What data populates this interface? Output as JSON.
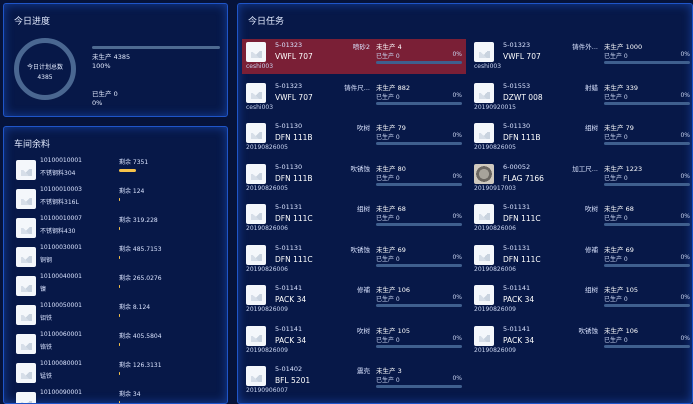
{
  "progress": {
    "title": "今日进度",
    "ring_label": "今日计划总数",
    "ring_value": "4385",
    "unproduced": "未生产 4385",
    "unproduced_pct": "100%",
    "produced": "已生产 0",
    "produced_pct": "0%",
    "produced_fraction": 0.0
  },
  "workshop": {
    "title": "车间余料",
    "items": [
      {
        "code": "10100010001",
        "name": "不锈钢料304",
        "remaining": "剩余 7351",
        "level": 1.0
      },
      {
        "code": "10100010003",
        "name": "不锈钢料316L",
        "remaining": "剩余 124",
        "level": 0.02
      },
      {
        "code": "10100010007",
        "name": "不锈钢料430",
        "remaining": "剩余 319.228",
        "level": 0.04
      },
      {
        "code": "10100030001",
        "name": "铜钢",
        "remaining": "剩余 485.7153",
        "level": 0.06
      },
      {
        "code": "10100040001",
        "name": "镍",
        "remaining": "剩余 265.0276",
        "level": 0.035
      },
      {
        "code": "10100050001",
        "name": "钼铁",
        "remaining": "剩余 8.124",
        "level": 0.005
      },
      {
        "code": "10100060001",
        "name": "铬铁",
        "remaining": "剩余 405.5804",
        "level": 0.055
      },
      {
        "code": "10100080001",
        "name": "锰铁",
        "remaining": "剩余 126.3131",
        "level": 0.02
      },
      {
        "code": "10100090001",
        "name": "",
        "remaining": "剩余 34",
        "level": 0.005
      }
    ]
  },
  "tasks": {
    "title": "今日任务",
    "items": [
      {
        "code": "5-01323",
        "model": "VWFL 707",
        "process": "喷砂2",
        "unproduced": "未生产 4",
        "produced": "已生产 0",
        "pct": "0%",
        "extra": "ceshi003",
        "active": true,
        "thumb": "placeholder"
      },
      {
        "code": "5-01323",
        "model": "VWFL 707",
        "process": "铸件外...",
        "unproduced": "未生产 1000",
        "produced": "已生产 0",
        "pct": "0%",
        "extra": "ceshi003",
        "active": false,
        "thumb": "placeholder"
      },
      {
        "code": "5-01323",
        "model": "VWFL 707",
        "process": "铸件尺...",
        "unproduced": "未生产 882",
        "produced": "已生产 0",
        "pct": "0%",
        "extra": "ceshi003",
        "active": false,
        "thumb": "placeholder"
      },
      {
        "code": "5-01553",
        "model": "DZWT 008",
        "process": "射蜡",
        "unproduced": "未生产 339",
        "produced": "已生产 0",
        "pct": "0%",
        "extra": "20190920015",
        "active": false,
        "thumb": "placeholder"
      },
      {
        "code": "5-01130",
        "model": "DFN 111B",
        "process": "吹树",
        "unproduced": "未生产 79",
        "produced": "已生产 0",
        "pct": "0%",
        "extra": "20190826005",
        "active": false,
        "thumb": "placeholder"
      },
      {
        "code": "5-01130",
        "model": "DFN 111B",
        "process": "组树",
        "unproduced": "未生产 79",
        "produced": "已生产 0",
        "pct": "0%",
        "extra": "20190826005",
        "active": false,
        "thumb": "placeholder"
      },
      {
        "code": "5-01130",
        "model": "DFN 111B",
        "process": "吹锈蚀",
        "unproduced": "未生产 80",
        "produced": "已生产 0",
        "pct": "0%",
        "extra": "20190826005",
        "active": false,
        "thumb": "placeholder"
      },
      {
        "code": "6-00052",
        "model": "FLAG 7166",
        "process": "加工尺...",
        "unproduced": "未生产 1223",
        "produced": "已生产 0",
        "pct": "0%",
        "extra": "20190917003",
        "active": false,
        "thumb": "metal"
      },
      {
        "code": "5-01131",
        "model": "DFN 111C",
        "process": "组树",
        "unproduced": "未生产 68",
        "produced": "已生产 0",
        "pct": "0%",
        "extra": "20190826006",
        "active": false,
        "thumb": "placeholder"
      },
      {
        "code": "5-01131",
        "model": "DFN 111C",
        "process": "吹树",
        "unproduced": "未生产 68",
        "produced": "已生产 0",
        "pct": "0%",
        "extra": "20190826006",
        "active": false,
        "thumb": "placeholder"
      },
      {
        "code": "5-01131",
        "model": "DFN 111C",
        "process": "吹锈蚀",
        "unproduced": "未生产 69",
        "produced": "已生产 0",
        "pct": "0%",
        "extra": "20190826006",
        "active": false,
        "thumb": "placeholder"
      },
      {
        "code": "5-01131",
        "model": "DFN 111C",
        "process": "修補",
        "unproduced": "未生产 69",
        "produced": "已生产 0",
        "pct": "0%",
        "extra": "20190826006",
        "active": false,
        "thumb": "placeholder"
      },
      {
        "code": "5-01141",
        "model": "PACK 34",
        "process": "修補",
        "unproduced": "未生产 106",
        "produced": "已生产 0",
        "pct": "0%",
        "extra": "20190826009",
        "active": false,
        "thumb": "placeholder"
      },
      {
        "code": "5-01141",
        "model": "PACK 34",
        "process": "组树",
        "unproduced": "未生产 105",
        "produced": "已生产 0",
        "pct": "0%",
        "extra": "20190826009",
        "active": false,
        "thumb": "placeholder"
      },
      {
        "code": "5-01141",
        "model": "PACK 34",
        "process": "吹树",
        "unproduced": "未生产 105",
        "produced": "已生产 0",
        "pct": "0%",
        "extra": "20190826009",
        "active": false,
        "thumb": "placeholder"
      },
      {
        "code": "5-01141",
        "model": "PACK 34",
        "process": "吹锈蚀",
        "unproduced": "未生产 106",
        "produced": "已生产 0",
        "pct": "0%",
        "extra": "20190826009",
        "active": false,
        "thumb": "placeholder"
      },
      {
        "code": "5-01402",
        "model": "BFL 5201",
        "process": "震壳",
        "unproduced": "未生产 3",
        "produced": "已生产 0",
        "pct": "0%",
        "extra": "20190906007",
        "active": false,
        "thumb": "placeholder"
      }
    ]
  }
}
